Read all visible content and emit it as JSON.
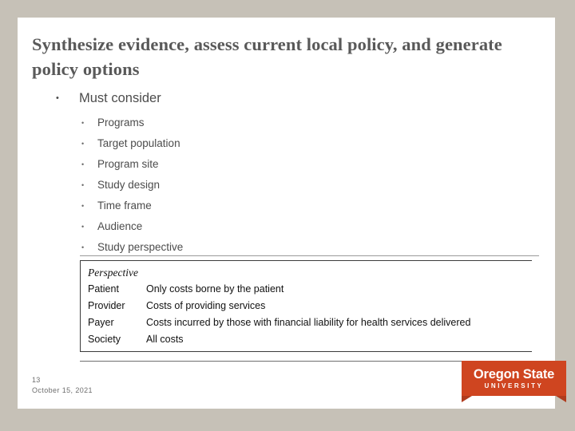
{
  "slide": {
    "title": "Synthesize evidence, assess current local policy, and generate policy options",
    "bullets_level1": [
      {
        "marker": "•",
        "text": "Must consider"
      }
    ],
    "bullets_level2": [
      {
        "marker": "•",
        "text": "Programs"
      },
      {
        "marker": "•",
        "text": "Target population"
      },
      {
        "marker": "•",
        "text": "Program site"
      },
      {
        "marker": "•",
        "text": "Study design"
      },
      {
        "marker": "•",
        "text": "Time frame"
      },
      {
        "marker": "•",
        "text": "Audience"
      },
      {
        "marker": "•",
        "text": "Study perspective"
      }
    ],
    "perspective_table": {
      "header": "Perspective",
      "rows": [
        {
          "label": "Patient",
          "description": "Only costs borne by the patient"
        },
        {
          "label": "Provider",
          "description": "Costs of providing services"
        },
        {
          "label": "Payer",
          "description": "Costs incurred by those with financial liability for health services delivered"
        },
        {
          "label": "Society",
          "description": "All costs"
        }
      ]
    },
    "footer": {
      "slide_number": "13",
      "date": "October 15, 2021"
    },
    "logo": {
      "wordmark": "Oregon State",
      "subword": "UNIVERSITY",
      "color": "#cf4520"
    },
    "colors": {
      "canvas_background": "#c6c1b7",
      "slide_background": "#ffffff",
      "title_text": "#595959",
      "body_text": "#4c4c4c",
      "table_text": "#111111",
      "footer_text": "#6e6e6e"
    }
  }
}
